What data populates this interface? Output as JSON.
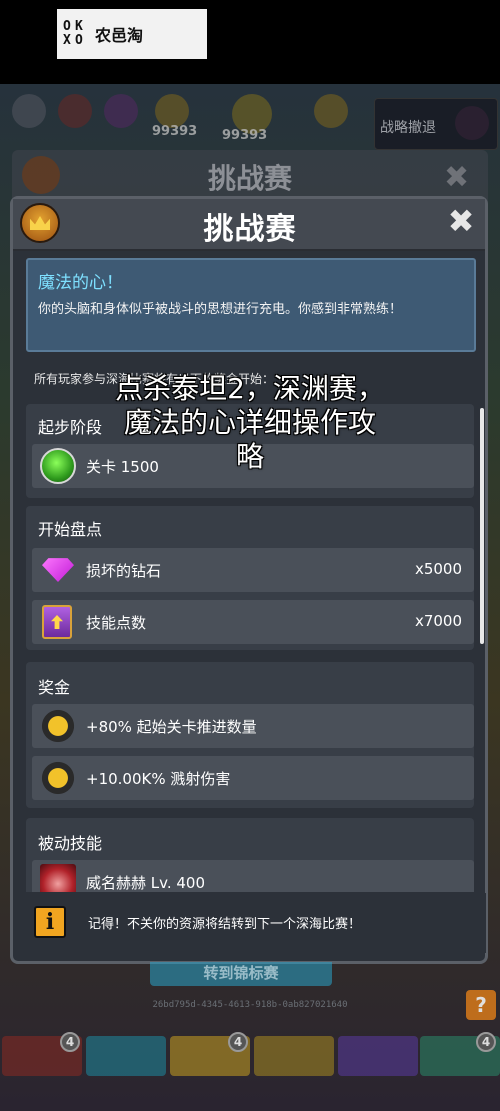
{
  "watermark": {
    "logo_text": "农邑淘"
  },
  "background": {
    "score_left": "99393",
    "score_center": "99393",
    "retreat_label": "战略撤退",
    "ghost_title": "挑战赛",
    "claim_button": "转到锦标赛",
    "hash": "26bd795d-4345-4613-918b-0ab827021640",
    "help_label": "?",
    "tab_badges": [
      "4",
      "4",
      "4"
    ]
  },
  "modal": {
    "title": "挑战赛",
    "close_label": "✖",
    "magic": {
      "title": "魔法的心！",
      "description": "你的头脑和身体似乎被战斗的思想进行充电。你感到非常熟练！"
    },
    "intro": "所有玩家参与深海比赛将有以下的奖金开始：",
    "start_stage": {
      "label": "起步阶段",
      "item_label": "关卡 1500"
    },
    "start_inventory": {
      "label": "开始盘点",
      "items": [
        {
          "label": "损坏的钻石",
          "value": "x5000",
          "icon": "diamond-icon"
        },
        {
          "label": "技能点数",
          "value": "x7000",
          "icon": "skill-book-icon"
        }
      ]
    },
    "bonus": {
      "label": "奖金",
      "items": [
        {
          "label": "+80% 起始关卡推进数量",
          "icon": "gear-bonus-icon"
        },
        {
          "label": "+10.00K% 溅射伤害",
          "icon": "gear-bonus-icon"
        }
      ]
    },
    "passive": {
      "label": "被动技能",
      "items": [
        {
          "label": "威名赫赫 Lv. 400",
          "icon": "passive-skill-icon"
        }
      ]
    },
    "note": {
      "icon_label": "i",
      "text": "记得！不关你的资源将结转到下一个深海比赛！"
    }
  },
  "caption": {
    "line1": "点杀泰坦2，深渊赛，",
    "line2": "魔法的心详细操作攻",
    "line3": "略"
  },
  "colors": {
    "magic_panel": "#3e5a74",
    "magic_title": "#7ee0ff",
    "modal_bg": "#2c3139",
    "row_bg": "#4a5059"
  }
}
